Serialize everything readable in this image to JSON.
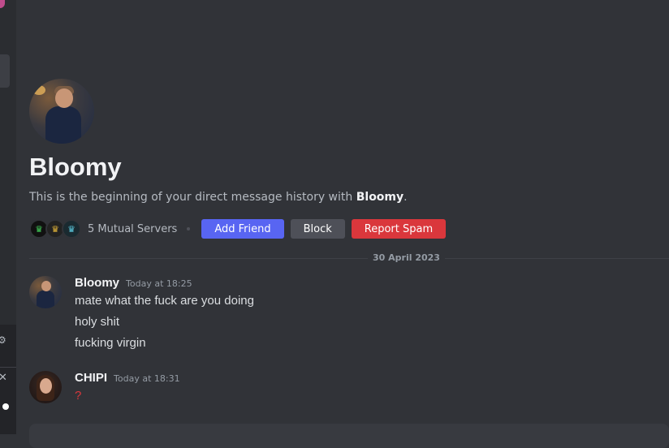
{
  "profile": {
    "name": "Bloomy",
    "intro_prefix": "This is the beginning of your direct message history with ",
    "intro_name": "Bloomy",
    "intro_suffix": ".",
    "mutual_servers": "5 Mutual Servers"
  },
  "actions": {
    "add_friend": "Add Friend",
    "block": "Block",
    "report_spam": "Report Spam"
  },
  "date_divider": "30 April 2023",
  "messages": [
    {
      "author": "Bloomy",
      "timestamp": "Today at 18:25",
      "lines": [
        "mate what the fuck are you doing",
        "holy shit",
        "fucking virgin"
      ]
    },
    {
      "author": "CHIPI",
      "timestamp": "Today at 18:31",
      "lines": [
        "?"
      ]
    }
  ],
  "colors": {
    "background": "#313338",
    "primary_button": "#5865f2",
    "secondary_button": "#4e5058",
    "danger_button": "#da373c"
  },
  "icons": {
    "mutual_server_icons": [
      "crown-server-icon",
      "crown-server-icon",
      "crown-server-icon"
    ]
  }
}
